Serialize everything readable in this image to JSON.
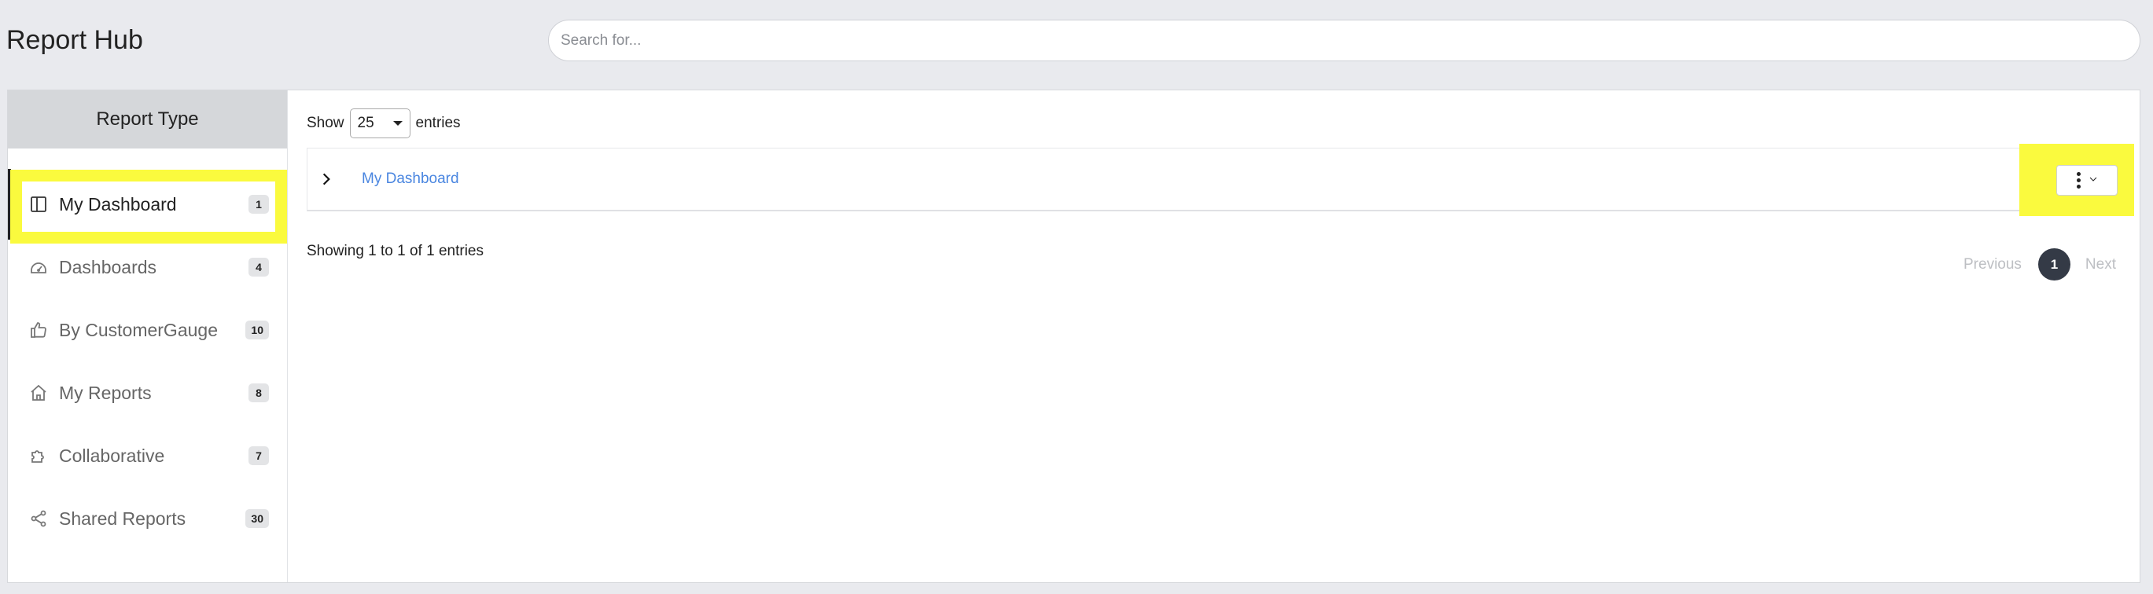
{
  "header": {
    "title": "Report Hub",
    "search_placeholder": "Search for..."
  },
  "sidebar": {
    "title": "Report Type",
    "items": [
      {
        "label": "My Dashboard",
        "count": "1",
        "icon": "layout-icon"
      },
      {
        "label": "Dashboards",
        "count": "4",
        "icon": "gauge-icon"
      },
      {
        "label": "By CustomerGauge",
        "count": "10",
        "icon": "thumbs-up-icon"
      },
      {
        "label": "My Reports",
        "count": "8",
        "icon": "home-icon"
      },
      {
        "label": "Collaborative",
        "count": "7",
        "icon": "puzzle-icon"
      },
      {
        "label": "Shared Reports",
        "count": "30",
        "icon": "share-icon"
      }
    ]
  },
  "table": {
    "show_label": "Show",
    "page_length": "25",
    "entries_label": "entries",
    "rows": [
      {
        "name": "My Dashboard"
      }
    ],
    "info": "Showing 1 to 1 of 1 entries"
  },
  "pagination": {
    "previous": "Previous",
    "current": "1",
    "next": "Next"
  },
  "colors": {
    "highlight": "#fafa3e",
    "link": "#4a86e0",
    "active_page": "#343a46"
  }
}
